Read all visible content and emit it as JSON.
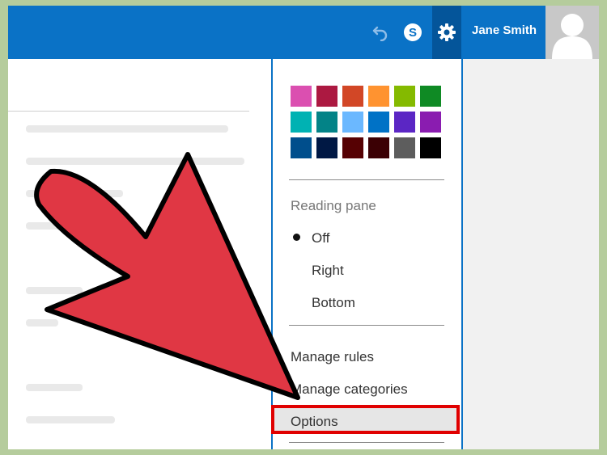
{
  "header": {
    "user_name": "Jane Smith",
    "icons": [
      "undo-icon",
      "skype-icon",
      "gear-icon",
      "avatar-icon"
    ],
    "bar_color": "#0a72c6",
    "gear_bg_color": "#04559a"
  },
  "settings_menu": {
    "theme_colors": [
      "#db4fb0",
      "#ac1941",
      "#d24726",
      "#ff9330",
      "#84ba00",
      "#0f8a24",
      "#00b2b3",
      "#038387",
      "#6bb8ff",
      "#0072c6",
      "#5b26c4",
      "#8a1cb0",
      "#004e8c",
      "#001844",
      "#560103",
      "#3b0004",
      "#5d5d5d",
      "#000000"
    ],
    "reading_pane": {
      "title": "Reading pane",
      "options": [
        "Off",
        "Right",
        "Bottom"
      ],
      "selected": "Off"
    },
    "manage_rules": "Manage rules",
    "manage_categories": "Manage categories",
    "options": "Options"
  },
  "annotation": {
    "arrow_color": "#e03744",
    "highlight_color": "#e00000"
  }
}
